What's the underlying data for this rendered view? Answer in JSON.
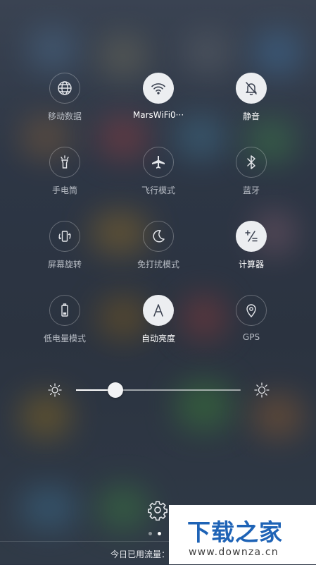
{
  "tiles": [
    {
      "label": "移动数据",
      "icon": "globe-icon",
      "on": false
    },
    {
      "label": "MarsWiFi0···",
      "icon": "wifi-icon",
      "on": true
    },
    {
      "label": "静音",
      "icon": "bell-off-icon",
      "on": true
    },
    {
      "label": "手电筒",
      "icon": "flashlight-icon",
      "on": false
    },
    {
      "label": "飞行模式",
      "icon": "airplane-icon",
      "on": false
    },
    {
      "label": "蓝牙",
      "icon": "bluetooth-icon",
      "on": false
    },
    {
      "label": "屏幕旋转",
      "icon": "rotate-icon",
      "on": false
    },
    {
      "label": "免打扰模式",
      "icon": "moon-icon",
      "on": false
    },
    {
      "label": "计算器",
      "icon": "calculator-icon",
      "on": true
    },
    {
      "label": "低电量模式",
      "icon": "battery-icon",
      "on": false
    },
    {
      "label": "自动亮度",
      "icon": "auto-brightness-icon",
      "on": true
    },
    {
      "label": "GPS",
      "icon": "location-pin-icon",
      "on": false
    }
  ],
  "brightness": {
    "level": 0.24
  },
  "pager": {
    "pages": 2,
    "active": 1
  },
  "bottom_bar": {
    "text": "今日已用流量："
  },
  "watermark": {
    "title": "下载之家",
    "url": "www.downza.cn"
  },
  "colors": {
    "tile_on_bg": "#eceef1",
    "tile_icon_on": "#3a4150",
    "watermark_blue": "#1e63b6"
  }
}
